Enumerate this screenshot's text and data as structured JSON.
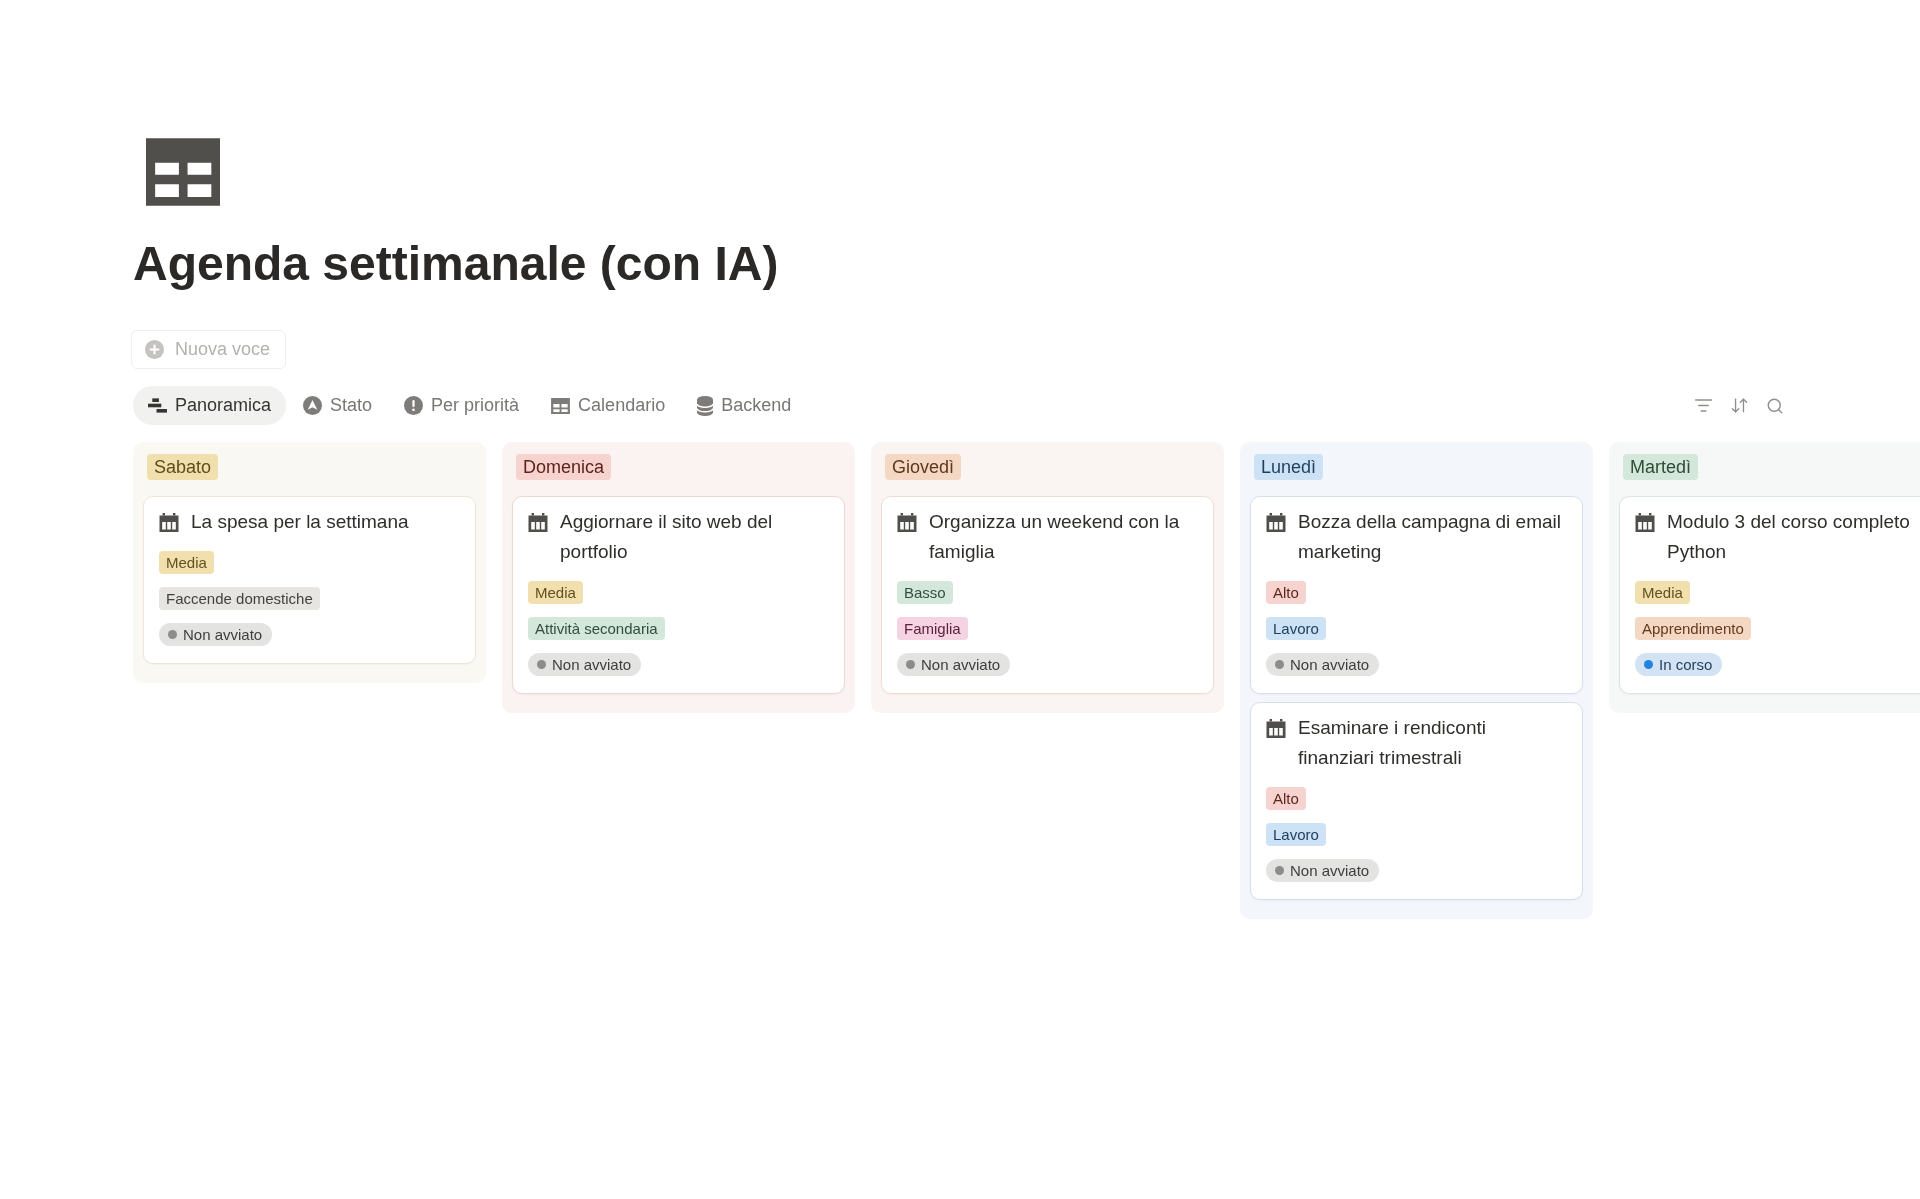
{
  "page": {
    "title": "Agenda settimanale (con IA)"
  },
  "new_item_button": {
    "label": "Nuova voce"
  },
  "views": [
    {
      "label": "Panoramica",
      "selected": true
    },
    {
      "label": "Stato",
      "selected": false
    },
    {
      "label": "Per priorità",
      "selected": false
    },
    {
      "label": "Calendario",
      "selected": false
    },
    {
      "label": "Backend",
      "selected": false
    }
  ],
  "columns": [
    {
      "label": "Sabato",
      "color": "#f1e0ad",
      "cards": [
        {
          "title": "La spesa per la settimana",
          "priority": {
            "label": "Media",
            "color": "#f1e0ad"
          },
          "category": {
            "label": "Faccende domestiche",
            "color": "#e6e5e2"
          },
          "status": {
            "label": "Non avviato",
            "color": "#8e8c88"
          }
        }
      ]
    },
    {
      "label": "Domenica",
      "color": "#f6d3cf",
      "cards": [
        {
          "title": "Aggiornare il sito web del portfolio",
          "priority": {
            "label": "Media",
            "color": "#f1e0ad"
          },
          "category": {
            "label": "Attività secondaria",
            "color": "#d3e7da"
          },
          "status": {
            "label": "Non avviato",
            "color": "#8e8c88"
          }
        }
      ]
    },
    {
      "label": "Giovedì",
      "color": "#f5d8c4",
      "cards": [
        {
          "title": "Organizza un weekend con la famiglia",
          "priority": {
            "label": "Basso",
            "color": "#d3e7da"
          },
          "category": {
            "label": "Famiglia",
            "color": "#f5d3e3"
          },
          "status": {
            "label": "Non avviato",
            "color": "#8e8c88"
          }
        }
      ]
    },
    {
      "label": "Lunedì",
      "color": "#cde2f5",
      "cards": [
        {
          "title": "Bozza della campagna di email marketing",
          "priority": {
            "label": "Alto",
            "color": "#f6d3cf"
          },
          "category": {
            "label": "Lavoro",
            "color": "#cde2f5"
          },
          "status": {
            "label": "Non avviato",
            "color": "#8e8c88"
          }
        },
        {
          "title": "Esaminare i rendiconti finanziari trimestrali",
          "priority": {
            "label": "Alto",
            "color": "#f6d3cf"
          },
          "category": {
            "label": "Lavoro",
            "color": "#cde2f5"
          },
          "status": {
            "label": "Non avviato",
            "color": "#8e8c88"
          }
        }
      ]
    },
    {
      "label": "Martedì",
      "color": "#d3e7da",
      "cards": [
        {
          "title": "Modulo 3 del corso completo\nPython",
          "priority": {
            "label": "Media",
            "color": "#f1e0ad"
          },
          "category": {
            "label": "Apprendimento",
            "color": "#f5d8c4"
          },
          "status": {
            "label": "In corso",
            "color": "#2383e2"
          }
        }
      ]
    }
  ]
}
